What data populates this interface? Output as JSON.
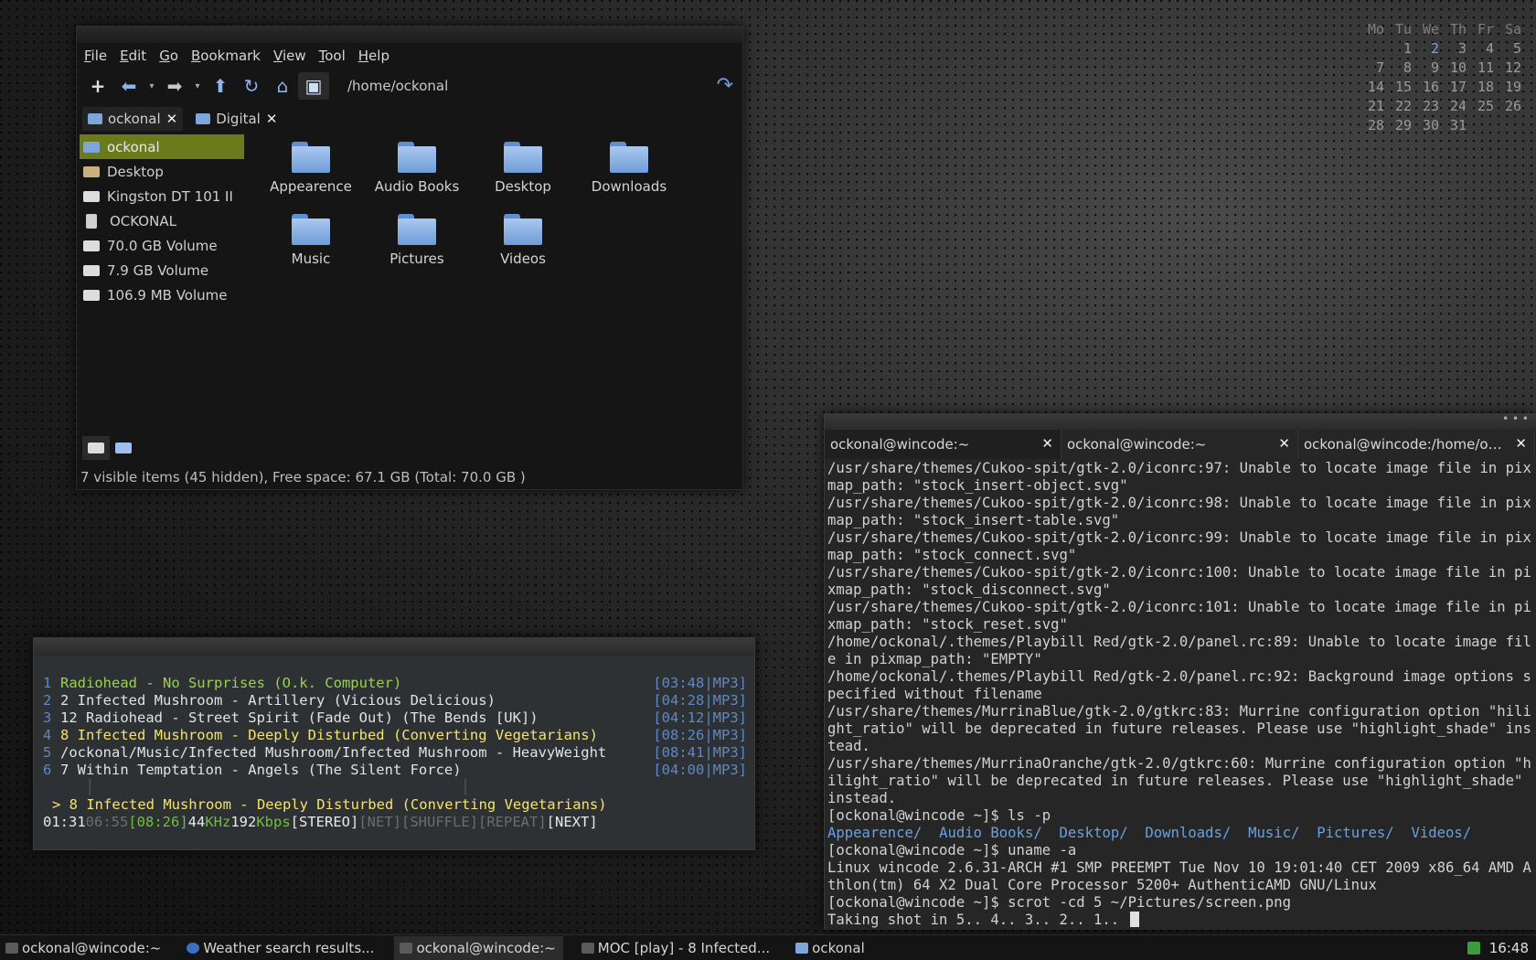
{
  "calendar": {
    "weekdays": [
      "Mo",
      "Tu",
      "We",
      "Th",
      "Fr",
      "Sa"
    ],
    "weeks": [
      [
        "",
        "1",
        "2",
        "3",
        "4",
        "5"
      ],
      [
        "7",
        "8",
        "9",
        "10",
        "11",
        "12"
      ],
      [
        "14",
        "15",
        "16",
        "17",
        "18",
        "19"
      ],
      [
        "21",
        "22",
        "23",
        "24",
        "25",
        "26"
      ],
      [
        "28",
        "29",
        "30",
        "31",
        "",
        ""
      ]
    ],
    "today": "2"
  },
  "file_manager": {
    "menu": [
      "File",
      "Edit",
      "Go",
      "Bookmark",
      "View",
      "Tool",
      "Help"
    ],
    "path": "/home/ockonal",
    "tabs": [
      {
        "label": "ockonal"
      },
      {
        "label": "Digital"
      }
    ],
    "sidebar": [
      {
        "label": "ockonal",
        "icon": "home-folder-icon"
      },
      {
        "label": "Desktop",
        "icon": "desktop-icon"
      },
      {
        "label": "Kingston DT 101 II",
        "icon": "drive-icon"
      },
      {
        "label": "OCKONAL",
        "icon": "media-player-icon"
      },
      {
        "label": "70.0 GB Volume",
        "icon": "drive-icon"
      },
      {
        "label": "7.9 GB Volume",
        "icon": "drive-icon"
      },
      {
        "label": "106.9 MB Volume",
        "icon": "drive-icon"
      }
    ],
    "folders": [
      "Appearence",
      "Audio Books",
      "Desktop",
      "Downloads",
      "Music",
      "Pictures",
      "Videos"
    ],
    "status": "7 visible items (45 hidden), Free space: 67.1 GB (Total: 70.0 GB )"
  },
  "moc": {
    "tracks": [
      {
        "num": "1",
        "name": "Radiohead - No Surprises (O.k. Computer)",
        "time": "[03:48|MP3]",
        "state": "play"
      },
      {
        "num": "2",
        "name": "2 Infected Mushroom - Artillery (Vicious Delicious)",
        "time": "[04:28|MP3]",
        "state": ""
      },
      {
        "num": "3",
        "name": "12 Radiohead - Street Spirit (Fade Out) (The Bends [UK])",
        "time": "[04:12|MP3]",
        "state": ""
      },
      {
        "num": "4",
        "name": "8 Infected Mushroom - Deeply Disturbed (Converting Vegetarians)",
        "time": "[08:26|MP3]",
        "state": "sel"
      },
      {
        "num": "5",
        "name": "/ockonal/Music/Infected Mushroom/Infected Mushroom - HeavyWeight",
        "time": "[08:41|MP3]",
        "state": ""
      },
      {
        "num": "6",
        "name": "7 Within Temptation - Angels (The Silent Force)",
        "time": "[04:00|MP3]",
        "state": ""
      }
    ],
    "now_playing": "> 8 Infected Mushroom - Deeply Disturbed (Converting Vegetarians)",
    "elapsed": "01:31",
    "remaining": "06:55",
    "total": "[08:26]",
    "rate": "44",
    "rate_unit": "KHz",
    "bitrate": "192",
    "bitrate_unit": "Kbps",
    "stereo": "[STEREO]",
    "net": "[NET]",
    "shuffle": "[SHUFFLE]",
    "repeat": "[REPEAT]",
    "next": "[NEXT]"
  },
  "terminal": {
    "tabs": [
      "ockonal@wincode:~",
      "ockonal@wincode:~",
      "ockonal@wincode:/home/ock..."
    ],
    "lines": [
      "/usr/share/themes/Cukoo-spit/gtk-2.0/iconrc:97: Unable to locate image file in pixmap_path: \"stock_insert-object.svg\"",
      "/usr/share/themes/Cukoo-spit/gtk-2.0/iconrc:98: Unable to locate image file in pixmap_path: \"stock_insert-table.svg\"",
      "/usr/share/themes/Cukoo-spit/gtk-2.0/iconrc:99: Unable to locate image file in pixmap_path: \"stock_connect.svg\"",
      "/usr/share/themes/Cukoo-spit/gtk-2.0/iconrc:100: Unable to locate image file in pixmap_path: \"stock_disconnect.svg\"",
      "/usr/share/themes/Cukoo-spit/gtk-2.0/iconrc:101: Unable to locate image file in pixmap_path: \"stock_reset.svg\"",
      "/home/ockonal/.themes/Playbill Red/gtk-2.0/panel.rc:89: Unable to locate image file in pixmap_path: \"EMPTY\"",
      "/home/ockonal/.themes/Playbill Red/gtk-2.0/panel.rc:92: Background image options specified without filename",
      "/usr/share/themes/MurrinaBlue/gtk-2.0/gtkrc:83: Murrine configuration option \"hilight_ratio\" will be deprecated in future releases. Please use \"highlight_shade\" instead.",
      "/usr/share/themes/MurrinaOranche/gtk-2.0/gtkrc:60: Murrine configuration option \"hilight_ratio\" will be deprecated in future releases. Please use \"highlight_shade\" instead.",
      "[ockonal@wincode ~]$ ls -p"
    ],
    "ls_dirs": [
      "Appearence/",
      "Audio Books/",
      "Desktop/",
      "Downloads/",
      "Music/",
      "Pictures/",
      "Videos/"
    ],
    "lines2": [
      "[ockonal@wincode ~]$ uname -a",
      "Linux wincode 2.6.31-ARCH #1 SMP PREEMPT Tue Nov 10 19:01:40 CET 2009 x86_64 AMD Athlon(tm) 64 X2 Dual Core Processor 5200+ AuthenticAMD GNU/Linux",
      "[ockonal@wincode ~]$ scrot -cd 5 ~/Pictures/screen.png",
      "Taking shot in 5.. 4.. 3.. 2.. 1.. "
    ]
  },
  "taskbar": {
    "tasks": [
      {
        "label": "ockonal@wincode:~",
        "icon": "terminal-icon",
        "active": false
      },
      {
        "label": "Weather search results...",
        "icon": "browser-icon",
        "active": false
      },
      {
        "label": "ockonal@wincode:~",
        "icon": "terminal-icon",
        "active": true
      },
      {
        "label": "MOC [play] - 8 Infected...",
        "icon": "terminal-icon",
        "active": false
      },
      {
        "label": "ockonal",
        "icon": "folder-icon",
        "active": false
      }
    ],
    "clock": "16:48"
  }
}
